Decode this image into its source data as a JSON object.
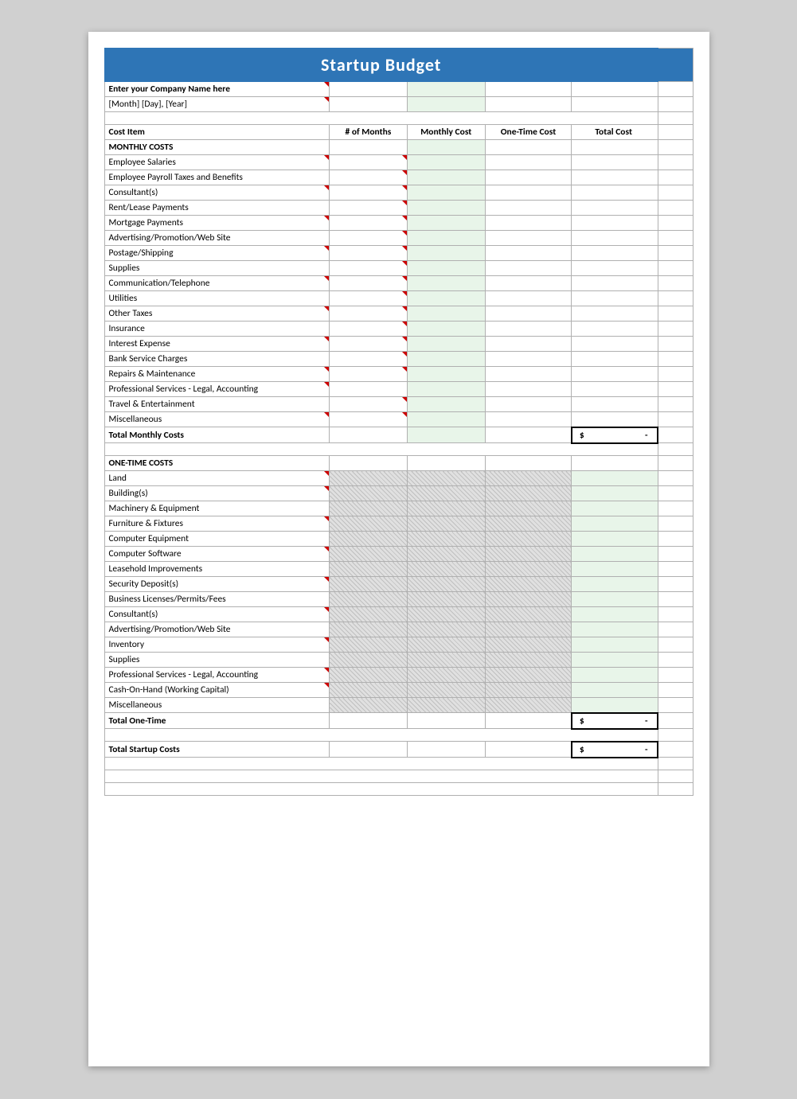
{
  "title": "Startup Budget",
  "company_name_label": "Enter your Company Name here",
  "date_label": "[Month] [Day], [Year]",
  "columns": {
    "cost_item": "Cost Item",
    "num_months": "# of Months",
    "monthly_cost": "Monthly Cost",
    "one_time_cost": "One-Time Cost",
    "total_cost": "Total Cost"
  },
  "monthly_section_header": "MONTHLY COSTS",
  "monthly_items": [
    "Employee Salaries",
    "Employee Payroll Taxes and Benefits",
    "Consultant(s)",
    "Rent/Lease Payments",
    "Mortgage Payments",
    "Advertising/Promotion/Web Site",
    "Postage/Shipping",
    "Supplies",
    "Communication/Telephone",
    "Utilities",
    "Other Taxes",
    "Insurance",
    "Interest Expense",
    "Bank Service Charges",
    "Repairs & Maintenance",
    "Professional Services - Legal, Accounting",
    "Travel & Entertainment",
    "Miscellaneous"
  ],
  "total_monthly_label": "Total Monthly Costs",
  "total_monthly_value": "$",
  "total_monthly_dash": "-",
  "onetime_section_header": "ONE-TIME COSTS",
  "onetime_items": [
    "Land",
    "Building(s)",
    "Machinery & Equipment",
    "Furniture & Fixtures",
    "Computer Equipment",
    "Computer Software",
    "Leasehold Improvements",
    "Security Deposit(s)",
    "Business Licenses/Permits/Fees",
    "Consultant(s)",
    "Advertising/Promotion/Web Site",
    "Inventory",
    "Supplies",
    "Professional Services - Legal, Accounting",
    "Cash-On-Hand (Working Capital)",
    "Miscellaneous"
  ],
  "total_onetime_label": "Total One-Time",
  "total_onetime_value": "$",
  "total_onetime_dash": "-",
  "total_startup_label": "Total Startup Costs",
  "total_startup_value": "$",
  "total_startup_dash": "-"
}
